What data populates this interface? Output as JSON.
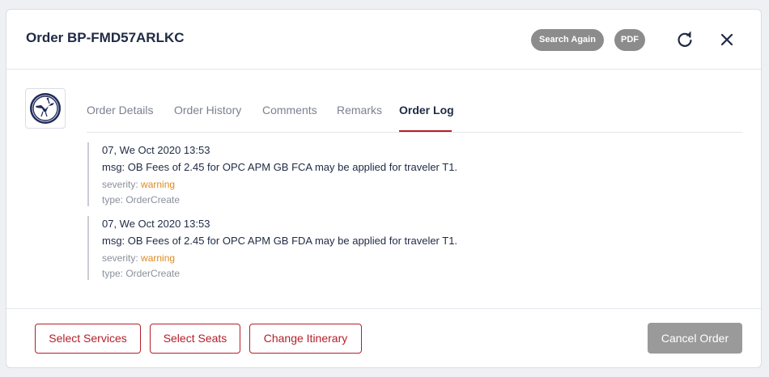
{
  "header": {
    "title": "Order BP-FMD57ARLKC",
    "search_again_label": "Search Again",
    "pdf_label": "PDF",
    "refresh_icon": "refresh-icon",
    "close_icon": "close-icon"
  },
  "airline_logo": {
    "icon": "lufthansa-crane-logo",
    "color": "#1f2a5a"
  },
  "tabs": [
    {
      "label": "Order Details",
      "active": false
    },
    {
      "label": "Order History",
      "active": false
    },
    {
      "label": "Comments",
      "active": false
    },
    {
      "label": "Remarks",
      "active": false
    },
    {
      "label": "Order Log",
      "active": true
    }
  ],
  "order_log": [
    {
      "date": "07, We Oct 2020 13:53",
      "msg": "msg: OB Fees of 2.45 for OPC APM GB FCA may be applied for traveler T1.",
      "severity_label": "severity:",
      "severity_value": "warning",
      "type": "type: OrderCreate"
    },
    {
      "date": "07, We Oct 2020 13:53",
      "msg": "msg: OB Fees of 2.45 for OPC APM GB FDA may be applied for traveler T1.",
      "severity_label": "severity:",
      "severity_value": "warning",
      "type": "type: OrderCreate"
    }
  ],
  "footer": {
    "select_services_label": "Select Services",
    "select_seats_label": "Select Seats",
    "change_itinerary_label": "Change Itinerary",
    "cancel_order_label": "Cancel Order"
  },
  "colors": {
    "accent": "#b4202a",
    "warning": "#e08a1e",
    "pill_bg": "#8c8c8c",
    "cancel_bg": "#9a9a9a"
  }
}
